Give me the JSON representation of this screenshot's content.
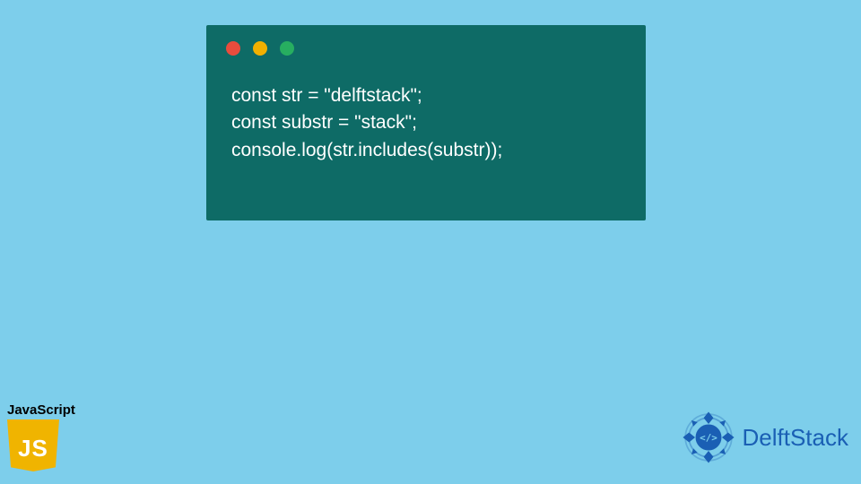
{
  "code": {
    "line1": "const str = \"delftstack\";",
    "line2": "const substr = \"stack\";",
    "line3": "console.log(str.includes(substr));"
  },
  "js_badge": {
    "label": "JavaScript",
    "logo_text": "JS"
  },
  "brand": {
    "name": "DelftStack"
  },
  "colors": {
    "background": "#7dceeb",
    "window": "#0e6b66",
    "dot_red": "#e84c3d",
    "dot_yellow": "#f1b000",
    "dot_green": "#27ae60",
    "js_yellow": "#f0b400",
    "brand_blue": "#1a5fb4"
  }
}
